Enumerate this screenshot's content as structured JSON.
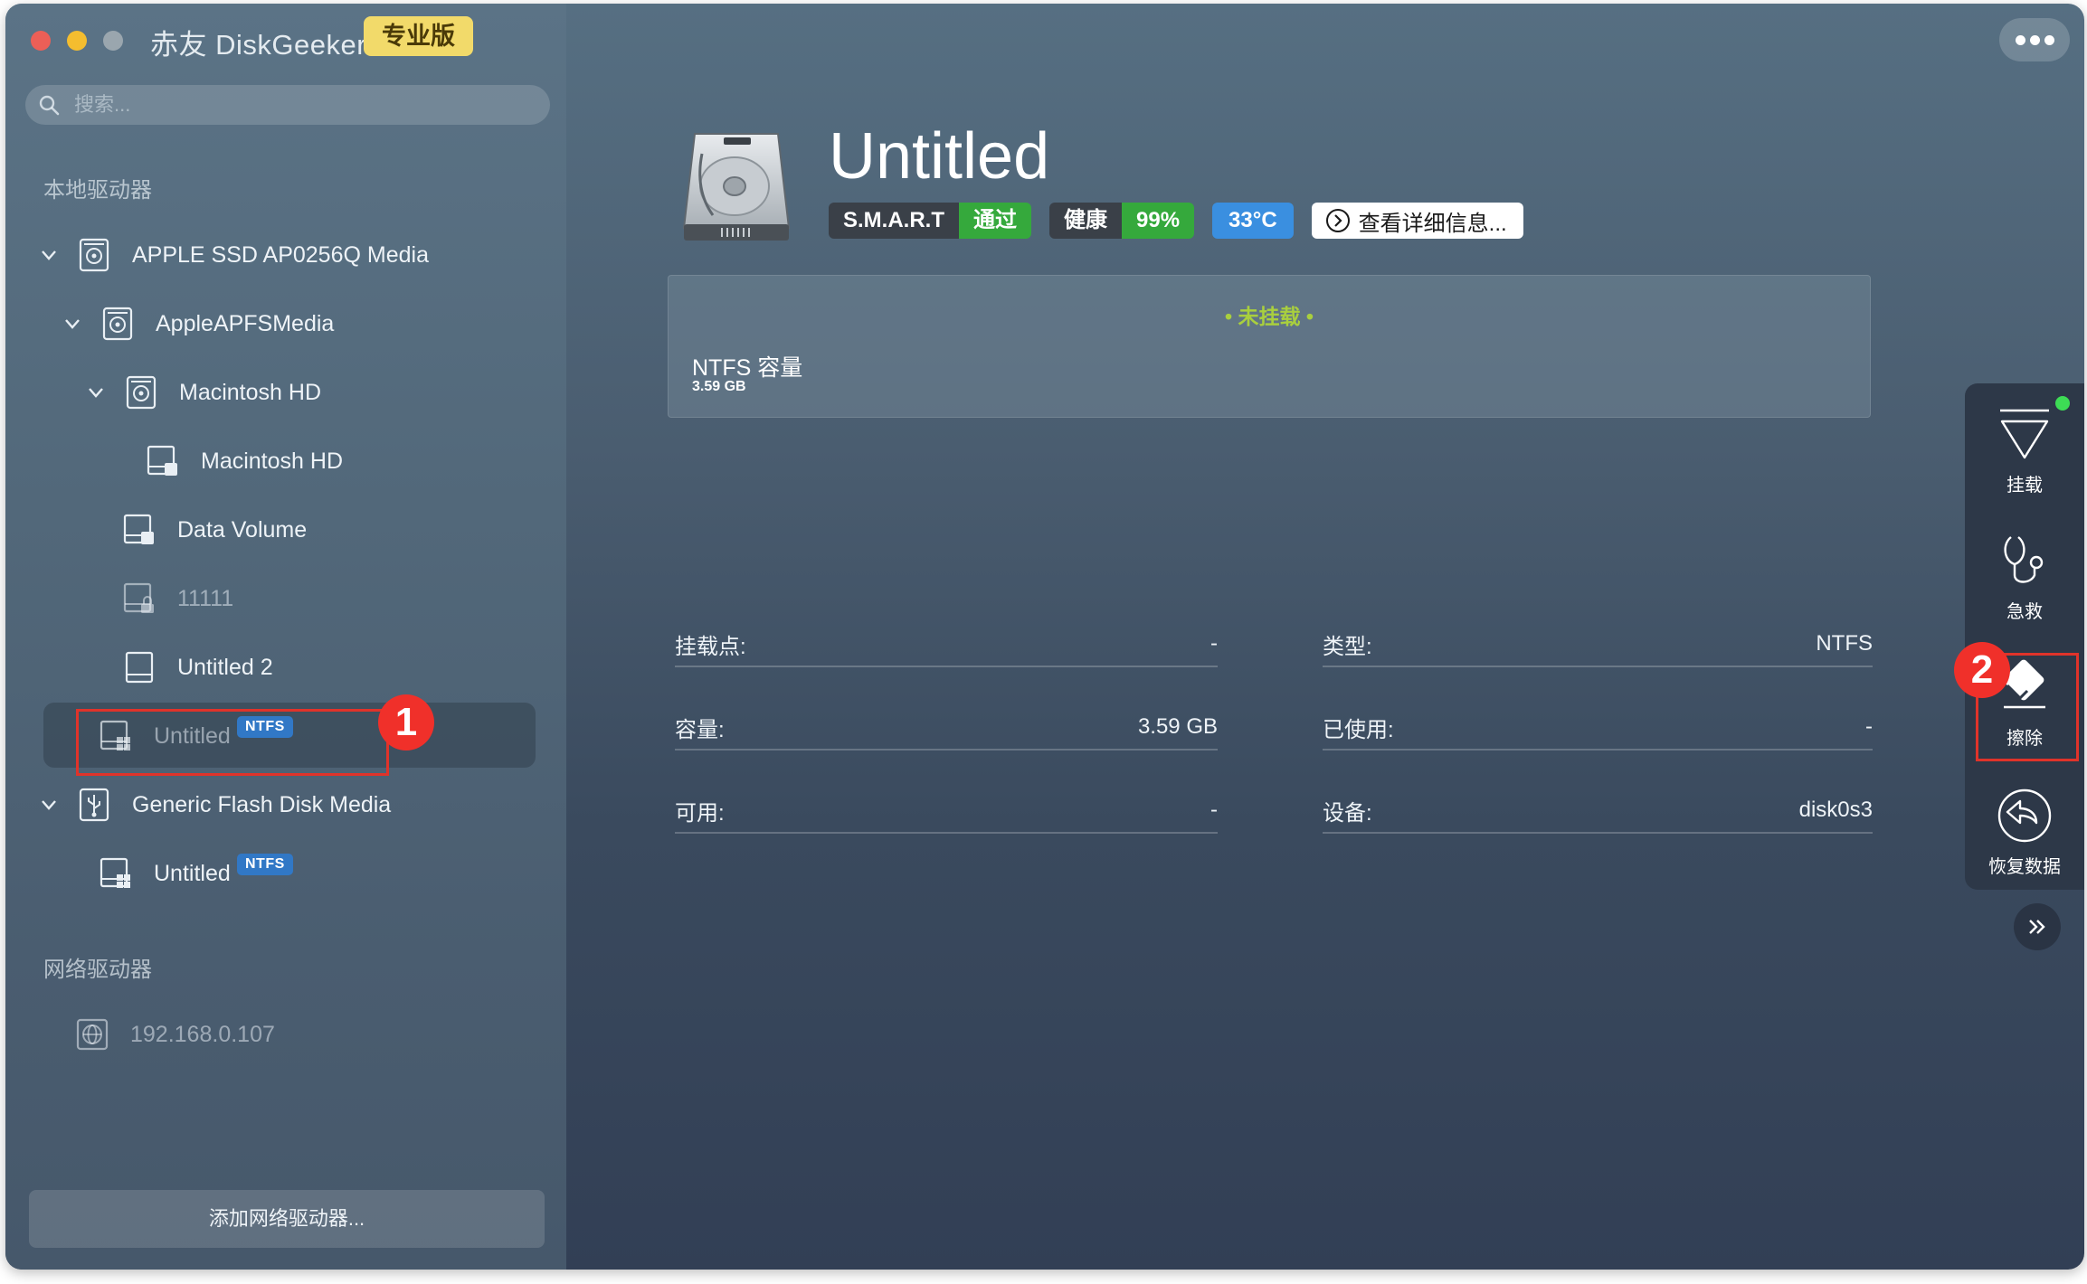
{
  "app": {
    "title": "赤友 DiskGeeker",
    "edition_badge": "专业版"
  },
  "search": {
    "placeholder": "搜索..."
  },
  "sidebar": {
    "local_section": "本地驱动器",
    "network_section": "网络驱动器",
    "items": [
      {
        "label": "APPLE SSD AP0256Q Media",
        "icon": "physical-disk-icon"
      },
      {
        "label": "AppleAPFSMedia",
        "icon": "physical-disk-icon"
      },
      {
        "label": "Macintosh HD",
        "icon": "physical-disk-icon"
      },
      {
        "label": "Macintosh HD",
        "icon": "volume-icon"
      },
      {
        "label": "Data Volume",
        "icon": "volume-icon"
      },
      {
        "label": "11111",
        "icon": "locked-volume-icon"
      },
      {
        "label": "Untitled 2",
        "icon": "volume-icon"
      },
      {
        "label": "Untitled",
        "badge": "NTFS",
        "icon": "windows-volume-icon"
      },
      {
        "label": "Generic Flash Disk Media",
        "icon": "usb-disk-icon"
      },
      {
        "label": "Untitled",
        "badge": "NTFS",
        "icon": "windows-volume-icon"
      }
    ],
    "network_items": [
      {
        "label": "192.168.0.107",
        "icon": "network-globe-icon"
      }
    ],
    "add_network_label": "添加网络驱动器..."
  },
  "annotations": {
    "step1": "1",
    "step2": "2"
  },
  "disk": {
    "title": "Untitled",
    "smart_label": "S.M.A.R.T",
    "smart_value": "通过",
    "health_label": "健康",
    "health_value": "99%",
    "temperature": "33°C",
    "details_button": "查看详细信息...",
    "status": "• 未挂载 •",
    "capacity_name": "NTFS 容量",
    "capacity_size": "3.59 GB"
  },
  "info": {
    "rows": [
      {
        "left_label": "挂载点:",
        "left_value": "-",
        "right_label": "类型:",
        "right_value": "NTFS"
      },
      {
        "left_label": "容量:",
        "left_value": "3.59 GB",
        "right_label": "已使用:",
        "right_value": "-"
      },
      {
        "left_label": "可用:",
        "left_value": "-",
        "right_label": "设备:",
        "right_value": "disk0s3"
      }
    ]
  },
  "toolbar": {
    "mount": "挂载",
    "rescue": "急救",
    "erase": "擦除",
    "recover": "恢复数据"
  },
  "colors": {
    "smart_pass": "#35a93c",
    "temperature": "#3a8fe0",
    "unmounted_status": "#a9cf3e",
    "ntfs_badge": "#3178c6",
    "annotation": "#e0332a"
  }
}
